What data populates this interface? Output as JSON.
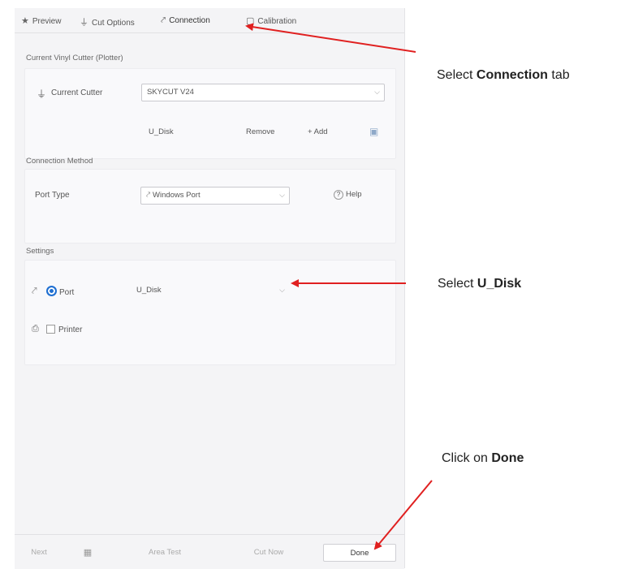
{
  "tabs": [
    {
      "label": "Preview",
      "icon": "star-icon"
    },
    {
      "label": "Cut Options",
      "icon": "cutter-icon"
    },
    {
      "label": "Connection",
      "icon": "connection-icon"
    },
    {
      "label": "Calibration",
      "icon": "calibration-icon"
    }
  ],
  "cutter_section": {
    "title": "Current Vinyl Cutter (Plotter)",
    "current_label": "Current Cutter",
    "current_value": "SKYCUT V24",
    "u_disk_label": "U_Disk",
    "remove_label": "Remove",
    "add_label": "Add"
  },
  "connection_section": {
    "title": "Connection Method",
    "port_type_label": "Port Type",
    "port_type_value": "Windows Port",
    "help_label": "Help"
  },
  "settings_section": {
    "title": "Settings",
    "port_label": "Port",
    "port_value": "U_Disk",
    "printer_label": "Printer"
  },
  "bottom_bar": {
    "next_label": "Next",
    "area_test_label": "Area Test",
    "cut_now_label": "Cut Now",
    "done_label": "Done"
  },
  "annotations": {
    "a1_prefix": "Select ",
    "a1_bold": "Connection",
    "a1_suffix": " tab",
    "a2_prefix": "Select ",
    "a2_bold": "U_Disk",
    "a3_prefix": "Click on ",
    "a3_bold": "Done"
  },
  "colors": {
    "arrow": "#e02020",
    "radio": "#1f6fd1"
  }
}
